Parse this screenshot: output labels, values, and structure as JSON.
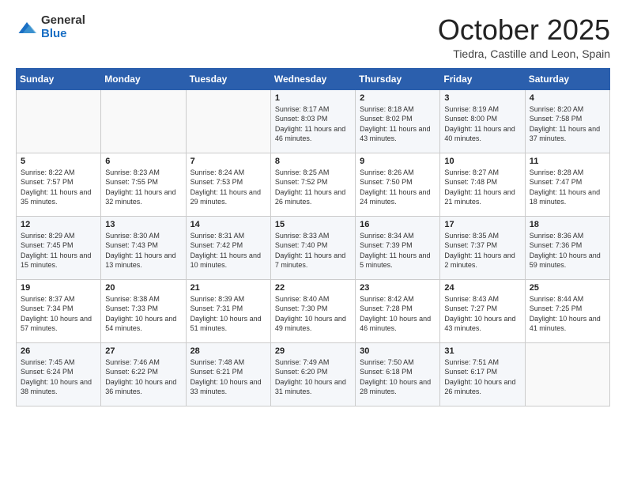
{
  "header": {
    "logo_general": "General",
    "logo_blue": "Blue",
    "month": "October 2025",
    "location": "Tiedra, Castille and Leon, Spain"
  },
  "weekdays": [
    "Sunday",
    "Monday",
    "Tuesday",
    "Wednesday",
    "Thursday",
    "Friday",
    "Saturday"
  ],
  "rows": [
    [
      {
        "day": "",
        "sunrise": "",
        "sunset": "",
        "daylight": ""
      },
      {
        "day": "",
        "sunrise": "",
        "sunset": "",
        "daylight": ""
      },
      {
        "day": "",
        "sunrise": "",
        "sunset": "",
        "daylight": ""
      },
      {
        "day": "1",
        "sunrise": "Sunrise: 8:17 AM",
        "sunset": "Sunset: 8:03 PM",
        "daylight": "Daylight: 11 hours and 46 minutes."
      },
      {
        "day": "2",
        "sunrise": "Sunrise: 8:18 AM",
        "sunset": "Sunset: 8:02 PM",
        "daylight": "Daylight: 11 hours and 43 minutes."
      },
      {
        "day": "3",
        "sunrise": "Sunrise: 8:19 AM",
        "sunset": "Sunset: 8:00 PM",
        "daylight": "Daylight: 11 hours and 40 minutes."
      },
      {
        "day": "4",
        "sunrise": "Sunrise: 8:20 AM",
        "sunset": "Sunset: 7:58 PM",
        "daylight": "Daylight: 11 hours and 37 minutes."
      }
    ],
    [
      {
        "day": "5",
        "sunrise": "Sunrise: 8:22 AM",
        "sunset": "Sunset: 7:57 PM",
        "daylight": "Daylight: 11 hours and 35 minutes."
      },
      {
        "day": "6",
        "sunrise": "Sunrise: 8:23 AM",
        "sunset": "Sunset: 7:55 PM",
        "daylight": "Daylight: 11 hours and 32 minutes."
      },
      {
        "day": "7",
        "sunrise": "Sunrise: 8:24 AM",
        "sunset": "Sunset: 7:53 PM",
        "daylight": "Daylight: 11 hours and 29 minutes."
      },
      {
        "day": "8",
        "sunrise": "Sunrise: 8:25 AM",
        "sunset": "Sunset: 7:52 PM",
        "daylight": "Daylight: 11 hours and 26 minutes."
      },
      {
        "day": "9",
        "sunrise": "Sunrise: 8:26 AM",
        "sunset": "Sunset: 7:50 PM",
        "daylight": "Daylight: 11 hours and 24 minutes."
      },
      {
        "day": "10",
        "sunrise": "Sunrise: 8:27 AM",
        "sunset": "Sunset: 7:48 PM",
        "daylight": "Daylight: 11 hours and 21 minutes."
      },
      {
        "day": "11",
        "sunrise": "Sunrise: 8:28 AM",
        "sunset": "Sunset: 7:47 PM",
        "daylight": "Daylight: 11 hours and 18 minutes."
      }
    ],
    [
      {
        "day": "12",
        "sunrise": "Sunrise: 8:29 AM",
        "sunset": "Sunset: 7:45 PM",
        "daylight": "Daylight: 11 hours and 15 minutes."
      },
      {
        "day": "13",
        "sunrise": "Sunrise: 8:30 AM",
        "sunset": "Sunset: 7:43 PM",
        "daylight": "Daylight: 11 hours and 13 minutes."
      },
      {
        "day": "14",
        "sunrise": "Sunrise: 8:31 AM",
        "sunset": "Sunset: 7:42 PM",
        "daylight": "Daylight: 11 hours and 10 minutes."
      },
      {
        "day": "15",
        "sunrise": "Sunrise: 8:33 AM",
        "sunset": "Sunset: 7:40 PM",
        "daylight": "Daylight: 11 hours and 7 minutes."
      },
      {
        "day": "16",
        "sunrise": "Sunrise: 8:34 AM",
        "sunset": "Sunset: 7:39 PM",
        "daylight": "Daylight: 11 hours and 5 minutes."
      },
      {
        "day": "17",
        "sunrise": "Sunrise: 8:35 AM",
        "sunset": "Sunset: 7:37 PM",
        "daylight": "Daylight: 11 hours and 2 minutes."
      },
      {
        "day": "18",
        "sunrise": "Sunrise: 8:36 AM",
        "sunset": "Sunset: 7:36 PM",
        "daylight": "Daylight: 10 hours and 59 minutes."
      }
    ],
    [
      {
        "day": "19",
        "sunrise": "Sunrise: 8:37 AM",
        "sunset": "Sunset: 7:34 PM",
        "daylight": "Daylight: 10 hours and 57 minutes."
      },
      {
        "day": "20",
        "sunrise": "Sunrise: 8:38 AM",
        "sunset": "Sunset: 7:33 PM",
        "daylight": "Daylight: 10 hours and 54 minutes."
      },
      {
        "day": "21",
        "sunrise": "Sunrise: 8:39 AM",
        "sunset": "Sunset: 7:31 PM",
        "daylight": "Daylight: 10 hours and 51 minutes."
      },
      {
        "day": "22",
        "sunrise": "Sunrise: 8:40 AM",
        "sunset": "Sunset: 7:30 PM",
        "daylight": "Daylight: 10 hours and 49 minutes."
      },
      {
        "day": "23",
        "sunrise": "Sunrise: 8:42 AM",
        "sunset": "Sunset: 7:28 PM",
        "daylight": "Daylight: 10 hours and 46 minutes."
      },
      {
        "day": "24",
        "sunrise": "Sunrise: 8:43 AM",
        "sunset": "Sunset: 7:27 PM",
        "daylight": "Daylight: 10 hours and 43 minutes."
      },
      {
        "day": "25",
        "sunrise": "Sunrise: 8:44 AM",
        "sunset": "Sunset: 7:25 PM",
        "daylight": "Daylight: 10 hours and 41 minutes."
      }
    ],
    [
      {
        "day": "26",
        "sunrise": "Sunrise: 7:45 AM",
        "sunset": "Sunset: 6:24 PM",
        "daylight": "Daylight: 10 hours and 38 minutes."
      },
      {
        "day": "27",
        "sunrise": "Sunrise: 7:46 AM",
        "sunset": "Sunset: 6:22 PM",
        "daylight": "Daylight: 10 hours and 36 minutes."
      },
      {
        "day": "28",
        "sunrise": "Sunrise: 7:48 AM",
        "sunset": "Sunset: 6:21 PM",
        "daylight": "Daylight: 10 hours and 33 minutes."
      },
      {
        "day": "29",
        "sunrise": "Sunrise: 7:49 AM",
        "sunset": "Sunset: 6:20 PM",
        "daylight": "Daylight: 10 hours and 31 minutes."
      },
      {
        "day": "30",
        "sunrise": "Sunrise: 7:50 AM",
        "sunset": "Sunset: 6:18 PM",
        "daylight": "Daylight: 10 hours and 28 minutes."
      },
      {
        "day": "31",
        "sunrise": "Sunrise: 7:51 AM",
        "sunset": "Sunset: 6:17 PM",
        "daylight": "Daylight: 10 hours and 26 minutes."
      },
      {
        "day": "",
        "sunrise": "",
        "sunset": "",
        "daylight": ""
      }
    ]
  ]
}
